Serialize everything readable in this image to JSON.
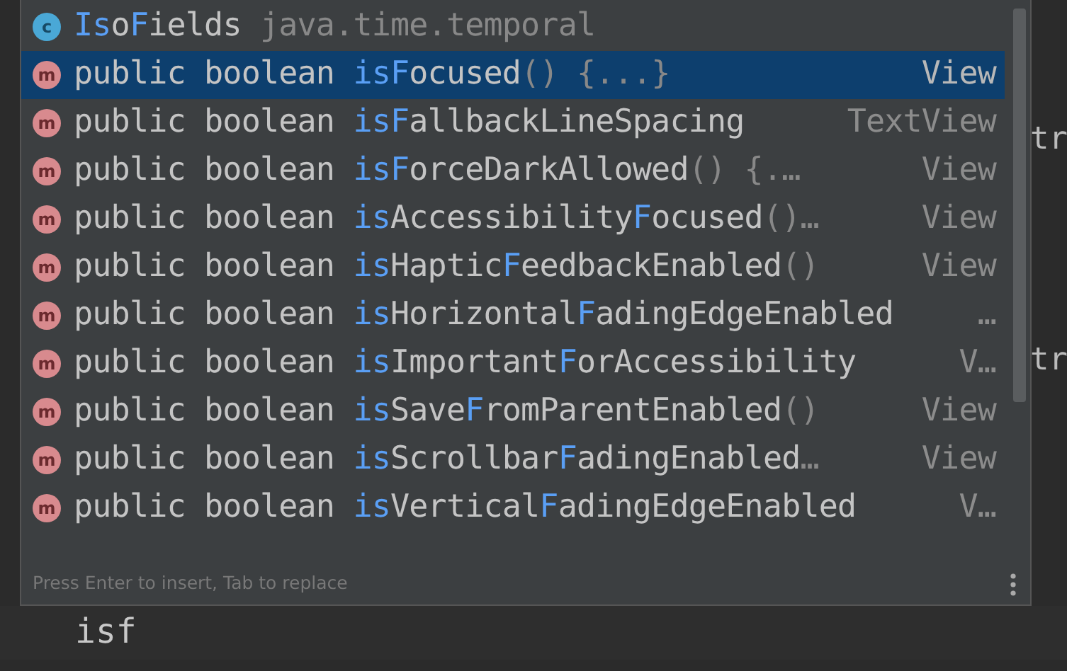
{
  "editor": {
    "fragments": [
      "tr",
      "tr"
    ],
    "typed_text": "isf"
  },
  "popup": {
    "items": [
      {
        "kind": "class",
        "icon_letter": "c",
        "selected": false,
        "name": [
          {
            "text": "Is",
            "match": true
          },
          {
            "text": "o",
            "match": false
          },
          {
            "text": "F",
            "match": true
          },
          {
            "text": "ields",
            "match": false
          }
        ],
        "suffix": " java.time.temporal"
      },
      {
        "kind": "method",
        "icon_letter": "m",
        "selected": true,
        "prefix": "public boolean ",
        "name": [
          {
            "text": "is",
            "match": true
          },
          {
            "text": "F",
            "match": true
          },
          {
            "text": "ocused",
            "match": false
          }
        ],
        "suffix": "() {...}",
        "type": "View"
      },
      {
        "kind": "method",
        "icon_letter": "m",
        "selected": false,
        "prefix": "public boolean ",
        "name": [
          {
            "text": "is",
            "match": true
          },
          {
            "text": "F",
            "match": true
          },
          {
            "text": "allbackLineSpacing",
            "match": false
          }
        ],
        "type": "TextView"
      },
      {
        "kind": "method",
        "icon_letter": "m",
        "selected": false,
        "prefix": "public boolean ",
        "name": [
          {
            "text": "is",
            "match": true
          },
          {
            "text": "F",
            "match": true
          },
          {
            "text": "orceDarkAllowed",
            "match": false
          }
        ],
        "suffix": "() {.…",
        "type": "View"
      },
      {
        "kind": "method",
        "icon_letter": "m",
        "selected": false,
        "prefix": "public boolean ",
        "name": [
          {
            "text": "is",
            "match": true
          },
          {
            "text": "Accessibility",
            "match": false
          },
          {
            "text": "F",
            "match": true
          },
          {
            "text": "ocused",
            "match": false
          }
        ],
        "suffix": "()…",
        "type": "View"
      },
      {
        "kind": "method",
        "icon_letter": "m",
        "selected": false,
        "prefix": "public boolean ",
        "name": [
          {
            "text": "is",
            "match": true
          },
          {
            "text": "Haptic",
            "match": false
          },
          {
            "text": "F",
            "match": true
          },
          {
            "text": "eedbackEnabled",
            "match": false
          }
        ],
        "suffix": "()",
        "type": "View"
      },
      {
        "kind": "method",
        "icon_letter": "m",
        "selected": false,
        "prefix": "public boolean ",
        "name": [
          {
            "text": "is",
            "match": true
          },
          {
            "text": "Horizontal",
            "match": false
          },
          {
            "text": "F",
            "match": true
          },
          {
            "text": "adingEdgeEnabled",
            "match": false
          }
        ],
        "type": "…"
      },
      {
        "kind": "method",
        "icon_letter": "m",
        "selected": false,
        "prefix": "public boolean ",
        "name": [
          {
            "text": "is",
            "match": true
          },
          {
            "text": "Important",
            "match": false
          },
          {
            "text": "F",
            "match": true
          },
          {
            "text": "orAccessibility",
            "match": false
          }
        ],
        "type": "V…"
      },
      {
        "kind": "method",
        "icon_letter": "m",
        "selected": false,
        "prefix": "public boolean ",
        "name": [
          {
            "text": "is",
            "match": true
          },
          {
            "text": "Save",
            "match": false
          },
          {
            "text": "F",
            "match": true
          },
          {
            "text": "romParentEnabled",
            "match": false
          }
        ],
        "suffix": "()",
        "type": "View"
      },
      {
        "kind": "method",
        "icon_letter": "m",
        "selected": false,
        "prefix": "public boolean ",
        "name": [
          {
            "text": "is",
            "match": true
          },
          {
            "text": "Scrollbar",
            "match": false
          },
          {
            "text": "F",
            "match": true
          },
          {
            "text": "adingEnabled",
            "match": false
          }
        ],
        "suffix": "…",
        "type": "View"
      },
      {
        "kind": "method",
        "icon_letter": "m",
        "selected": false,
        "prefix": "public boolean ",
        "name": [
          {
            "text": "is",
            "match": true
          },
          {
            "text": "Vertical",
            "match": false
          },
          {
            "text": "F",
            "match": true
          },
          {
            "text": "adingEdgeEnabled",
            "match": false
          }
        ],
        "type": "V…"
      }
    ],
    "footer_hint": "Press Enter to insert, Tab to replace"
  }
}
